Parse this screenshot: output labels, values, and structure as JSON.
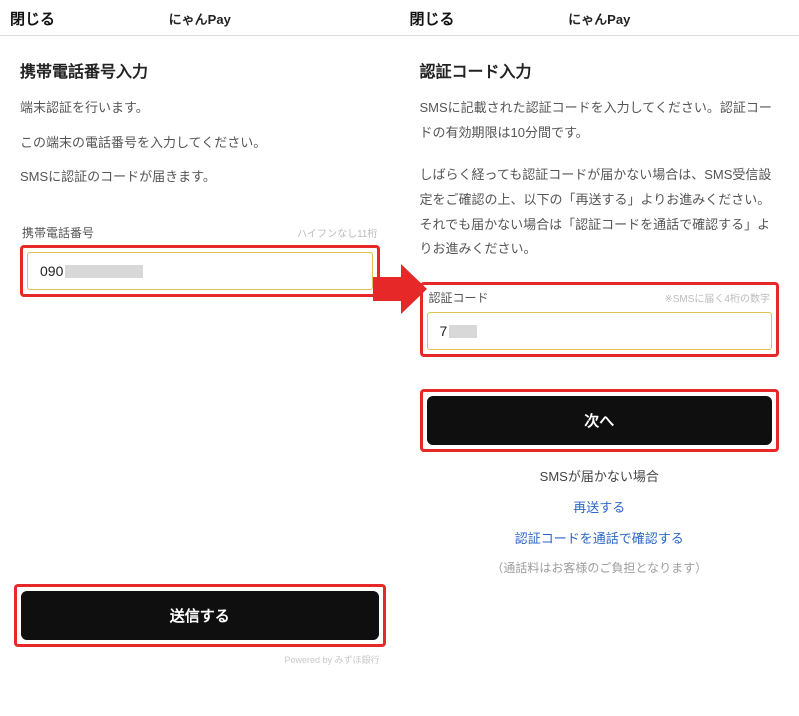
{
  "left": {
    "header": {
      "close": "閉じる",
      "title": "にゃんPay"
    },
    "pageTitle": "携帯電話番号入力",
    "desc1": "端末認証を行います。",
    "desc2": "この端末の電話番号を入力してください。",
    "desc3": "SMSに認証のコードが届きます。",
    "fieldLabel": "携帯電話番号",
    "fieldHint": "ハイフンなし11桁",
    "inputValue": "090",
    "submit": "送信する",
    "powered": "Powered by みずほ銀行"
  },
  "right": {
    "header": {
      "close": "閉じる",
      "title": "にゃんPay"
    },
    "pageTitle": "認証コード入力",
    "desc1": "SMSに記載された認証コードを入力してください。認証コードの有効期限は10分間です。",
    "desc2": "しばらく経っても認証コードが届かない場合は、SMS受信設定をご確認の上、以下の「再送する」よりお進みください。それでも届かない場合は「認証コードを通話で確認する」よりお進みください。",
    "fieldLabel": "認証コード",
    "fieldHint": "※SMSに届く4桁の数字",
    "inputValue": "7",
    "submit": "次へ",
    "helpHeading": "SMSが届かない場合",
    "resend": "再送する",
    "callConfirm": "認証コードを通話で確認する",
    "note": "（通話料はお客様のご負担となります）"
  }
}
